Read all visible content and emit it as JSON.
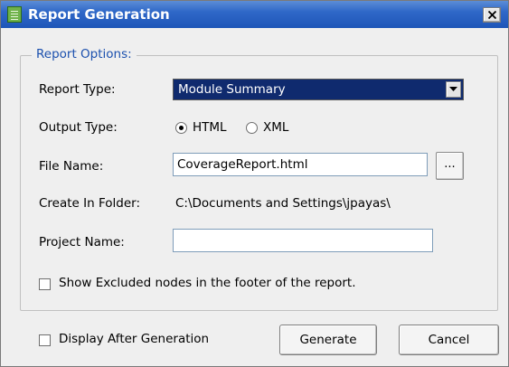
{
  "window": {
    "title": "Report Generation",
    "icon": "report-icon",
    "close_icon": "close-icon"
  },
  "group": {
    "legend": "Report Options:"
  },
  "report_type": {
    "label": "Report Type:",
    "value": "Module Summary"
  },
  "output_type": {
    "label": "Output Type:",
    "options": [
      {
        "label": "HTML",
        "selected": true
      },
      {
        "label": "XML",
        "selected": false
      }
    ]
  },
  "file_name": {
    "label": "File Name:",
    "value": "CoverageReport.html",
    "browse_label": "..."
  },
  "folder": {
    "label": "Create In Folder:",
    "value": "C:\\Documents and Settings\\jpayas\\"
  },
  "project_name": {
    "label": "Project Name:",
    "value": ""
  },
  "show_excluded": {
    "label": "Show Excluded nodes in the footer of the report.",
    "checked": false
  },
  "display_after": {
    "label": "Display After Generation",
    "checked": false
  },
  "buttons": {
    "generate": "Generate",
    "cancel": "Cancel"
  }
}
